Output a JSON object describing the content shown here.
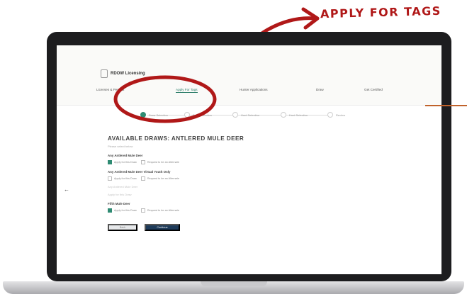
{
  "annotation": {
    "text": "APPLY FOR TAGS",
    "color": "#b01818"
  },
  "app": {
    "logo": "RDOW Licensing",
    "nav": [
      "Licenses & Permits",
      "Apply For Tags",
      "Hunter Applications",
      "Draw",
      "Get Certified"
    ],
    "nav_active_index": 1,
    "steps": [
      "Draw Selection",
      "Entry Selection",
      "Hunt Selection",
      "Hunt Selection",
      "Review"
    ],
    "step_active_index": 0,
    "title": "AVAILABLE DRAWS: ANTLERED MULE DEER",
    "subtitle": "Please select below",
    "sections": [
      {
        "title": "Any Antlered Mule Deer",
        "options": [
          "Apply for this Draw",
          "Request to be an Alternate"
        ],
        "checked": [
          true,
          false
        ]
      },
      {
        "title": "Any Antlered Mule Deer Virtual Youth Only",
        "options": [
          "Apply for this Draw",
          "Request to be an Alternate"
        ],
        "checked": [
          false,
          false
        ]
      },
      {
        "title": "Fifth Mule Deer",
        "options": [
          "Apply for this Draw",
          "Request to be an Alternate"
        ],
        "checked": [
          true,
          false
        ]
      }
    ],
    "faint_lines": [
      "Any Antlered Mule Deer",
      "Apply for this Draw"
    ],
    "buttons": {
      "back": "Back",
      "next": "Continue"
    },
    "colors": {
      "accent": "#2f8b73",
      "primary_button": "#1e3b5a"
    }
  }
}
